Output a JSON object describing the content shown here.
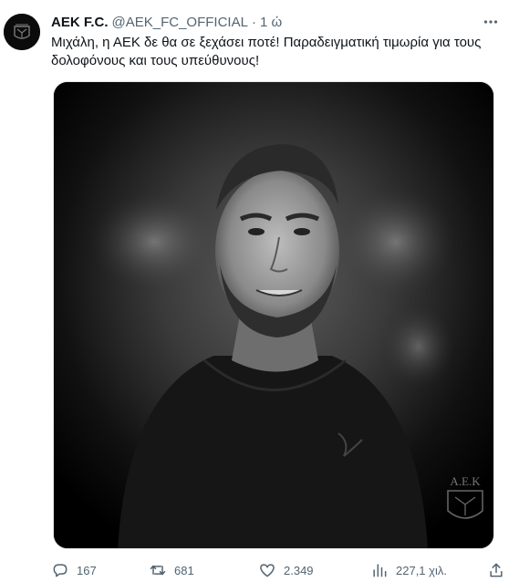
{
  "tweet": {
    "author": {
      "display_name": "AEK F.C.",
      "handle": "@AEK_FC_OFFICIAL",
      "separator": "·",
      "time": "1 ώ",
      "avatar_icon": "aek-logo-avatar"
    },
    "text": "Μιχάλη, η ΑΕΚ δε θα σε ξεχάσει ποτέ! Παραδειγματική τιμωρία για τους δολοφόνους και τους υπεύθυνους!",
    "media": {
      "watermark_text": "Α.Ε.Κ",
      "watermark_icon": "double-headed-eagle-icon"
    },
    "actions": {
      "replies": "167",
      "retweets": "681",
      "likes": "2.349",
      "views": "227,1 χιλ."
    }
  },
  "colors": {
    "text": "#0f1419",
    "secondary": "#536471",
    "media_background": "#000000"
  }
}
